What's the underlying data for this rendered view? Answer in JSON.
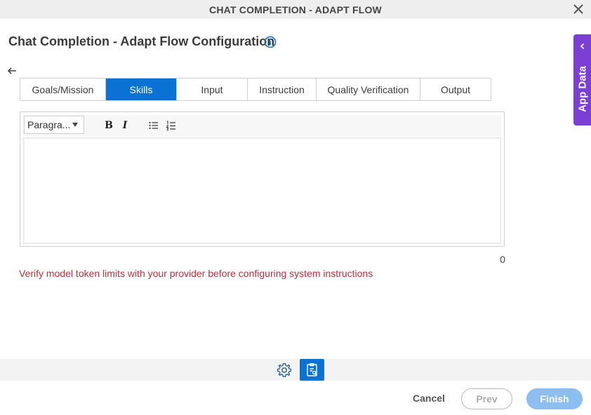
{
  "window": {
    "title": "CHAT COMPLETION - ADAPT FLOW"
  },
  "page": {
    "heading": "Chat Completion - Adapt Flow Configuration"
  },
  "tabs": [
    {
      "label": "Goals/Mission",
      "active": false
    },
    {
      "label": "Skills",
      "active": true
    },
    {
      "label": "Input",
      "active": false
    },
    {
      "label": "Instruction",
      "active": false
    },
    {
      "label": "Quality Verification",
      "active": false
    },
    {
      "label": "Output",
      "active": false
    }
  ],
  "editor": {
    "format_select": "Paragra...",
    "bold_label": "B",
    "italic_label": "I",
    "content": "",
    "char_count": "0"
  },
  "warning": {
    "text": "Verify model token limits with your provider before configuring system instructions"
  },
  "side_panel": {
    "label": "App Data"
  },
  "footer": {
    "cancel_label": "Cancel",
    "prev_label": "Prev",
    "finish_label": "Finish"
  },
  "colors": {
    "accent": "#0a72d2",
    "side_panel": "#7b3fd6",
    "warning": "#b8323a",
    "finish_disabled": "#8cbfef"
  },
  "icons": {
    "close": "close-icon",
    "info": "info-icon",
    "back": "back-arrow-icon",
    "chevron": "chevron-left-icon",
    "bulleted_list": "bulleted-list-icon",
    "numbered_list": "numbered-list-icon",
    "settings": "gear-icon",
    "document": "document-icon"
  }
}
